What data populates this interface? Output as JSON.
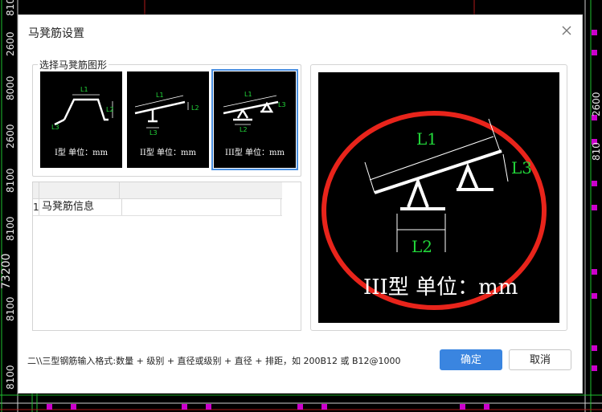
{
  "background": {
    "left_labels": [
      "810",
      "2600",
      "8000",
      "2600",
      "8100",
      "8100",
      "73200",
      "8100",
      "8100"
    ],
    "right_labels": [
      "2600",
      "810"
    ]
  },
  "dialog": {
    "title": "马凳筋设置",
    "group_title": "选择马凳筋图形",
    "shapes": [
      {
        "caption": "I型 单位：mm",
        "selected": false
      },
      {
        "caption": "II型 单位：mm",
        "selected": false
      },
      {
        "caption": "III型 单位：mm",
        "selected": true
      }
    ],
    "table": {
      "rows": [
        {
          "index": "1",
          "name": "马凳筋信息",
          "value": ""
        }
      ]
    },
    "preview": {
      "label_l1": "L1",
      "label_l2": "L2",
      "label_l3": "L3",
      "caption": "III型 单位：mm"
    },
    "hint": "二\\\\三型钢筋输入格式:数量 + 级别 + 直径或级别 + 直径 + 排距，如 200B12 或 B12@1000",
    "ok_label": "确定",
    "cancel_label": "取消"
  },
  "colors": {
    "accent": "#3a85e0",
    "cad_green": "#22d83a",
    "cad_magenta": "#cc00cc",
    "annotation_red": "#e8241b"
  }
}
